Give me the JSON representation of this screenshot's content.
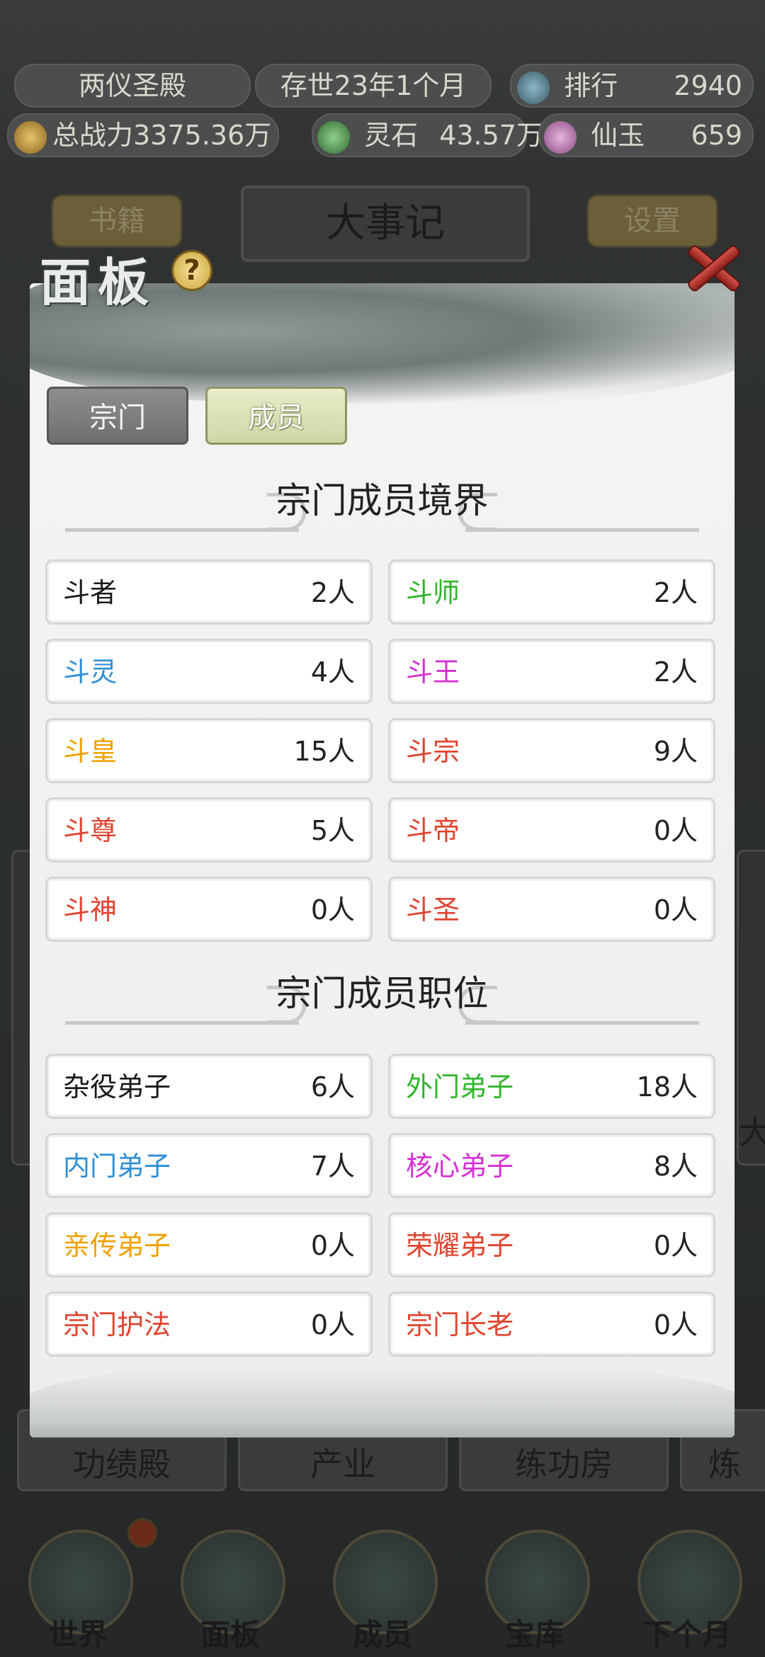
{
  "status_bar": {
    "sect_name": "两仪圣殿",
    "age": "存世23年1个月",
    "rank_label": "排行",
    "rank_value": "2940",
    "power": "总战力3375.36万",
    "spirit_stone_label": "灵石",
    "spirit_stone_value": "43.57万",
    "jade_label": "仙玉",
    "jade_value": "659"
  },
  "background": {
    "left_button": "书籍",
    "title": "大事记",
    "right_button": "设置",
    "bottom_tabs": [
      "功绩殿",
      "产业",
      "练功房",
      "炼"
    ],
    "right_edge_char": "大"
  },
  "bottom_nav": [
    {
      "label": "世界",
      "icon": "world-icon"
    },
    {
      "label": "面板",
      "icon": "panel-icon"
    },
    {
      "label": "成员",
      "icon": "members-icon"
    },
    {
      "label": "宝库",
      "icon": "treasury-icon"
    },
    {
      "label": "下个月",
      "icon": "next-month-icon"
    }
  ],
  "panel": {
    "title": "面板",
    "help": "?",
    "tabs": [
      {
        "label": "宗门",
        "active": false
      },
      {
        "label": "成员",
        "active": true
      }
    ],
    "realm_section_title": "宗门成员境界",
    "realms": [
      {
        "name": "斗者",
        "count": "2人",
        "color": "#1a1a1a"
      },
      {
        "name": "斗师",
        "count": "2人",
        "color": "#2fb52a"
      },
      {
        "name": "斗灵",
        "count": "4人",
        "color": "#2f8fd8"
      },
      {
        "name": "斗王",
        "count": "2人",
        "color": "#d42fd1"
      },
      {
        "name": "斗皇",
        "count": "15人",
        "color": "#f0a100"
      },
      {
        "name": "斗宗",
        "count": "9人",
        "color": "#e0432e"
      },
      {
        "name": "斗尊",
        "count": "5人",
        "color": "#e0432e"
      },
      {
        "name": "斗帝",
        "count": "0人",
        "color": "#e0432e"
      },
      {
        "name": "斗神",
        "count": "0人",
        "color": "#e0432e"
      },
      {
        "name": "斗圣",
        "count": "0人",
        "color": "#e0432e"
      }
    ],
    "position_section_title": "宗门成员职位",
    "positions": [
      {
        "name": "杂役弟子",
        "count": "6人",
        "color": "#1a1a1a"
      },
      {
        "name": "外门弟子",
        "count": "18人",
        "color": "#2fb52a"
      },
      {
        "name": "内门弟子",
        "count": "7人",
        "color": "#2f8fd8"
      },
      {
        "name": "核心弟子",
        "count": "8人",
        "color": "#d42fd1"
      },
      {
        "name": "亲传弟子",
        "count": "0人",
        "color": "#f0a100"
      },
      {
        "name": "荣耀弟子",
        "count": "0人",
        "color": "#e0432e"
      },
      {
        "name": "宗门护法",
        "count": "0人",
        "color": "#e0432e"
      },
      {
        "name": "宗门长老",
        "count": "0人",
        "color": "#e0432e"
      }
    ]
  }
}
